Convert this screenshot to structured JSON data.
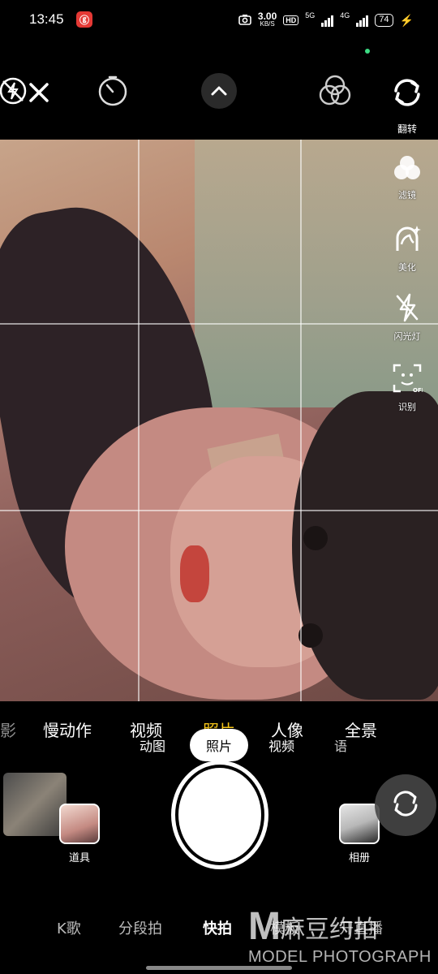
{
  "status_bar": {
    "time": "13:45",
    "app_icon_glyph": "ⓖ",
    "speed_value": "3.00",
    "speed_unit": "KB/S",
    "hd": "HD",
    "net_1": "5G",
    "net_2": "4G",
    "battery": "74",
    "charging_color": "#3ddc84"
  },
  "top_bar": {
    "icons": [
      "flash-off-icon",
      "close-icon",
      "timer-icon",
      "chevron-up-icon",
      "color-filter-icon",
      "flip-camera-icon"
    ],
    "flip_label": "翻转"
  },
  "side_tools": [
    {
      "icon": "filter-icon",
      "label": "滤镜"
    },
    {
      "icon": "beauty-icon",
      "label": "美化"
    },
    {
      "icon": "flash-off-icon",
      "label": "闪光灯"
    },
    {
      "icon": "face-detect-icon",
      "label": "识别"
    }
  ],
  "modes": {
    "items": [
      "影",
      "慢动作",
      "视频",
      "照片",
      "人像",
      "全景"
    ],
    "active": "照片",
    "active_color": "#f5c518"
  },
  "sub_modes": {
    "items": [
      "动图",
      "照片",
      "视频",
      "语"
    ],
    "active": "照片"
  },
  "bottom_controls": {
    "props_label": "道具",
    "album_label": "相册"
  },
  "bottom_tabs": {
    "items": [
      "K歌",
      "分段拍",
      "快拍",
      "模板",
      "开直播"
    ],
    "active": "快拍"
  },
  "watermark": {
    "letter": "M",
    "cn": "麻豆约拍",
    "en": "MODEL PHOTOGRAPH"
  }
}
